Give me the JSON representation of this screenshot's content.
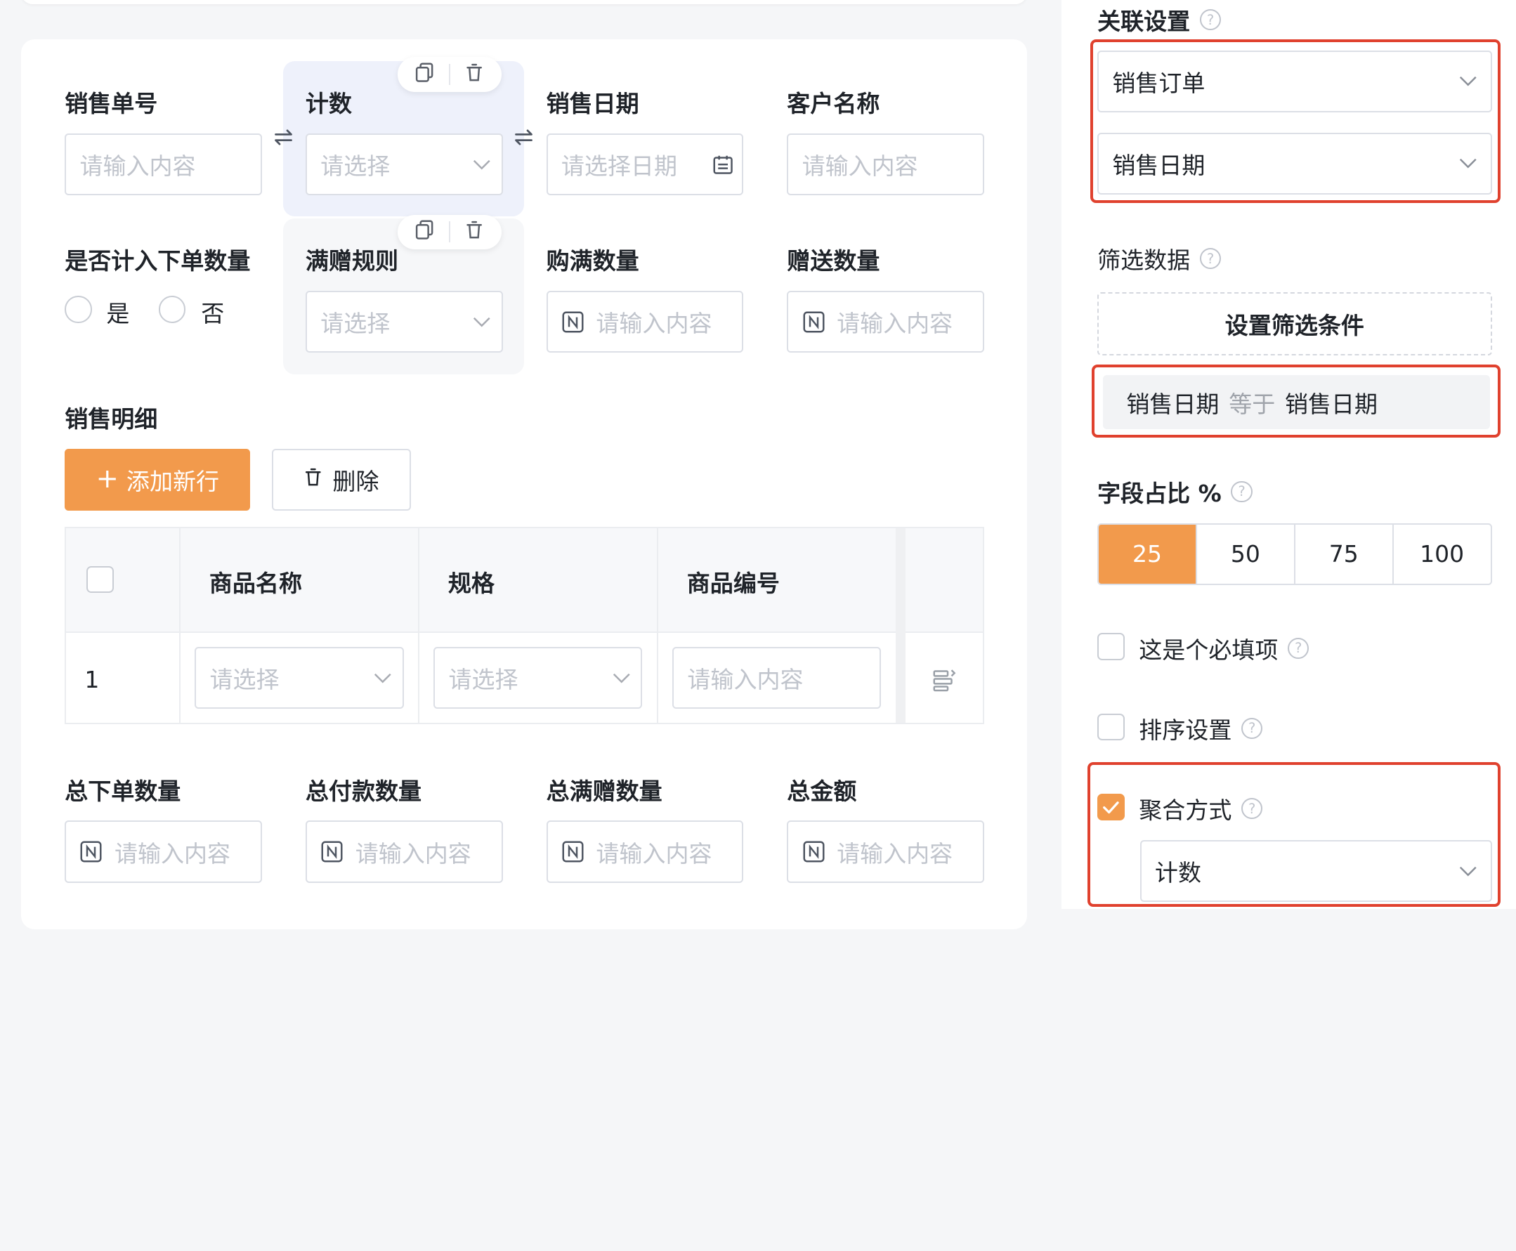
{
  "form": {
    "row1": {
      "order_no_label": "销售单号",
      "order_no_placeholder": "请输入内容",
      "count_label": "计数",
      "count_placeholder": "请选择",
      "sale_date_label": "销售日期",
      "sale_date_placeholder": "请选择日期",
      "customer_label": "客户名称",
      "customer_placeholder": "请输入内容"
    },
    "row2": {
      "count_in_orders_label": "是否计入下单数量",
      "radio_yes": "是",
      "radio_no": "否",
      "gift_rule_label": "满赠规则",
      "gift_rule_placeholder": "请选择",
      "full_qty_label": "购满数量",
      "full_qty_placeholder": "请输入内容",
      "gift_qty_label": "赠送数量",
      "gift_qty_placeholder": "请输入内容"
    },
    "detail": {
      "title": "销售明细",
      "add_row_label": "添加新行",
      "delete_label": "删除",
      "columns": [
        "商品名称",
        "规格",
        "商品编号"
      ],
      "rows": [
        {
          "index": "1",
          "name_placeholder": "请选择",
          "spec_placeholder": "请选择",
          "code_placeholder": "请输入内容"
        }
      ]
    },
    "row3": {
      "total_order_qty_label": "总下单数量",
      "total_paid_qty_label": "总付款数量",
      "total_gift_qty_label": "总满赠数量",
      "total_amount_label": "总金额",
      "placeholder": "请输入内容"
    }
  },
  "side": {
    "relation_title": "关联设置",
    "relation_form": "销售订单",
    "relation_field": "销售日期",
    "filter_title": "筛选数据",
    "filter_button": "设置筛选条件",
    "condition": {
      "left": "销售日期",
      "op": "等于",
      "right": "销售日期"
    },
    "width_title": "字段占比 %",
    "width_options": [
      "25",
      "50",
      "75",
      "100"
    ],
    "width_selected": "25",
    "required_label": "这是个必填项",
    "required_checked": false,
    "sort_label": "排序设置",
    "sort_checked": false,
    "aggregate_label": "聚合方式",
    "aggregate_checked": true,
    "aggregate_value": "计数"
  },
  "colors": {
    "accent": "#f29a4c",
    "highlight": "#e0412e",
    "selected_bg": "#eef1fb"
  }
}
